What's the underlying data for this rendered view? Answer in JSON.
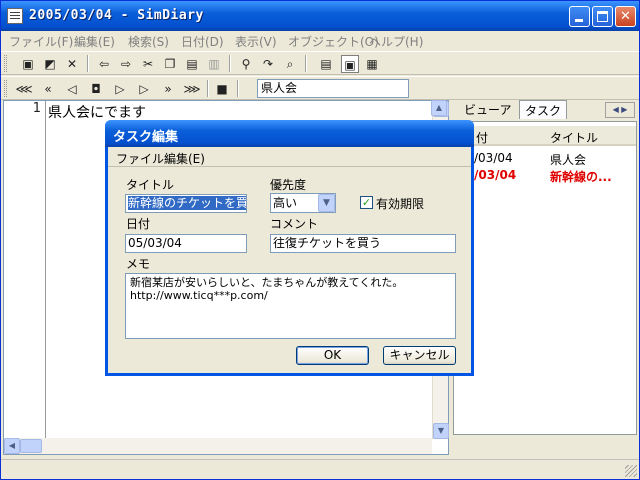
{
  "window": {
    "title": "2005/03/04 - SimDiary"
  },
  "menubar": {
    "items": [
      "ファイル(F)",
      "編集(E)",
      "検索(S)",
      "日付(D)",
      "表示(V)",
      "オブジェクト(O)",
      "ヘルプ(H)"
    ]
  },
  "toolbar2": {
    "search_value": "県人会"
  },
  "editor": {
    "line_number": "1",
    "text": "県人会にでます"
  },
  "right_pane": {
    "tabs": [
      "ビューア",
      "タスク"
    ],
    "active_tab": "タスク",
    "columns": [
      "付",
      "タイトル"
    ],
    "rows": [
      {
        "date": "/03/04",
        "title": "県人会",
        "highlight": false
      },
      {
        "date": "/03/04",
        "title": "新幹線の...",
        "highlight": true
      }
    ],
    "highlight_color": "#e00000"
  },
  "dialog": {
    "title": "タスク編集",
    "menu": [
      "ファイル",
      "編集(E)"
    ],
    "title_label": "タイトル",
    "title_value": "新幹線のチケットを買う",
    "priority_label": "優先度",
    "priority_value": "高い",
    "expiry_label": "有効期限",
    "expiry_checked": true,
    "date_label": "日付",
    "date_value": "05/03/04",
    "comment_label": "コメント",
    "comment_value": "往復チケットを買う",
    "memo_label": "メモ",
    "memo_lines": [
      "新宿某店が安いらしいと、たまちゃんが教えてくれた。",
      "http://www.ticq***p.com/"
    ],
    "ok_label": "OK",
    "cancel_label": "キャンセル"
  },
  "colors": {
    "titlebar": "#0a5fd8",
    "window_bg": "#ece9d8"
  }
}
